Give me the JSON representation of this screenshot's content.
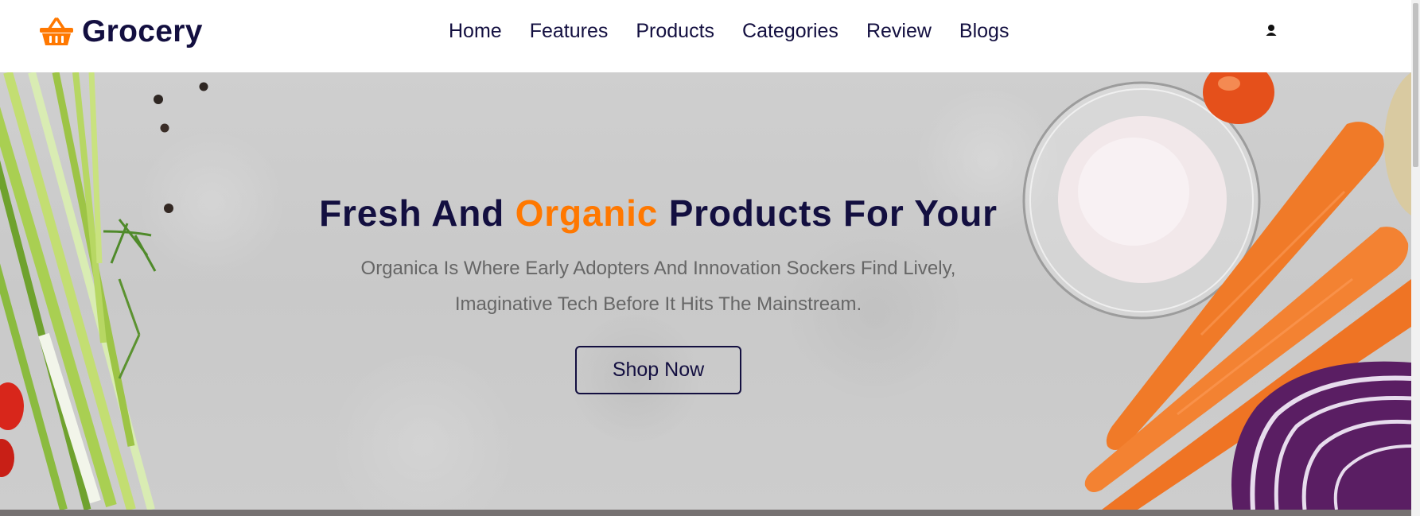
{
  "brand": {
    "name": "Grocery",
    "icon": "shopping-basket-icon",
    "accent_color": "#ff7800",
    "primary_color": "#130f40"
  },
  "nav": {
    "items": [
      {
        "label": "Home"
      },
      {
        "label": "Features"
      },
      {
        "label": "Products"
      },
      {
        "label": "Categories"
      },
      {
        "label": "Review"
      },
      {
        "label": "Blogs"
      }
    ]
  },
  "header": {
    "user_icon": "user-icon"
  },
  "hero": {
    "title_start": "Fresh And ",
    "title_accent": "Organic",
    "title_end": " Products For Your",
    "description": "Organica Is Where Early Adopters And Innovation Sockers Find Lively, Imaginative Tech Before It Hits The Mainstream.",
    "cta_label": "Shop Now"
  }
}
